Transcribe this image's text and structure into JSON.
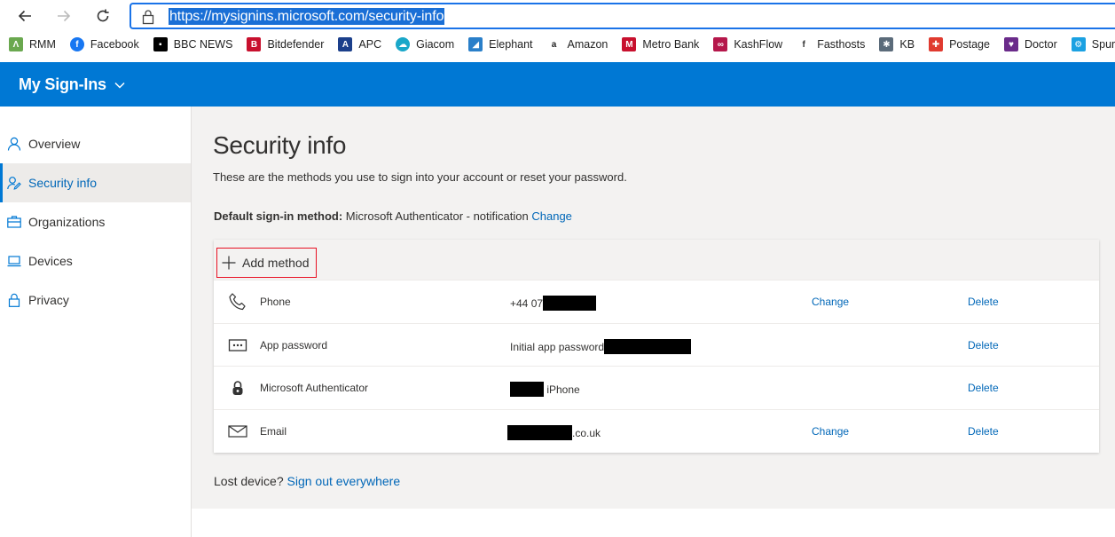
{
  "browser": {
    "url": "https://mysignins.microsoft.com/security-info",
    "bookmarks": [
      {
        "label": "RMM",
        "icon": "rmm-icon",
        "color": "#6aa84f"
      },
      {
        "label": "Facebook",
        "icon": "facebook-icon",
        "color": "#1877f2"
      },
      {
        "label": "BBC NEWS",
        "icon": "bbc-icon",
        "color": "#000000"
      },
      {
        "label": "Bitdefender",
        "icon": "bitdefender-icon",
        "color": "#c8102e"
      },
      {
        "label": "APC",
        "icon": "apc-icon",
        "color": "#1b3f8b"
      },
      {
        "label": "Giacom",
        "icon": "giacom-icon",
        "color": "#19a7c9"
      },
      {
        "label": "Elephant",
        "icon": "elephant-icon",
        "color": "#2a7fc9"
      },
      {
        "label": "Amazon",
        "icon": "amazon-icon",
        "color": "#222222"
      },
      {
        "label": "Metro Bank",
        "icon": "metro-bank-icon",
        "color": "#c8102e"
      },
      {
        "label": "KashFlow",
        "icon": "kashflow-icon",
        "color": "#b5174b"
      },
      {
        "label": "Fasthosts",
        "icon": "fasthosts-icon",
        "color": "#333333"
      },
      {
        "label": "KB",
        "icon": "kb-icon",
        "color": "#5b6b7a"
      },
      {
        "label": "Postage",
        "icon": "postage-icon",
        "color": "#e03a2f"
      },
      {
        "label": "Doctor",
        "icon": "doctor-icon",
        "color": "#6a2b8a"
      },
      {
        "label": "Spurs",
        "icon": "spurs-icon",
        "color": "#1ba1e2"
      }
    ]
  },
  "header": {
    "title": "My Sign-Ins",
    "brand_color": "#0078d4"
  },
  "sidebar": {
    "items": [
      {
        "label": "Overview",
        "icon": "person-icon",
        "active": false
      },
      {
        "label": "Security info",
        "icon": "security-info-icon",
        "active": true
      },
      {
        "label": "Organizations",
        "icon": "briefcase-icon",
        "active": false
      },
      {
        "label": "Devices",
        "icon": "laptop-icon",
        "active": false
      },
      {
        "label": "Privacy",
        "icon": "lock-icon",
        "active": false
      }
    ]
  },
  "main": {
    "title": "Security info",
    "description": "These are the methods you use to sign into your account or reset your password.",
    "default_label": "Default sign-in method:",
    "default_value": "Microsoft Authenticator - notification",
    "default_change": "Change",
    "add_method": "Add method",
    "methods": [
      {
        "name": "Phone",
        "icon": "phone-icon",
        "value_prefix": "+44 07",
        "value_suffix": "",
        "change": "Change",
        "delete": "Delete"
      },
      {
        "name": "App password",
        "icon": "app-password-icon",
        "value_prefix": "Initial app password",
        "value_suffix": "",
        "change": "",
        "delete": "Delete"
      },
      {
        "name": "Microsoft Authenticator",
        "icon": "authenticator-icon",
        "value_prefix": "",
        "value_suffix": " iPhone",
        "change": "",
        "delete": "Delete"
      },
      {
        "name": "Email",
        "icon": "mail-icon",
        "value_prefix": "",
        "value_suffix": ".co.uk",
        "change": "Change",
        "delete": "Delete"
      }
    ],
    "lost_device": "Lost device?",
    "sign_out": "Sign out everywhere"
  }
}
